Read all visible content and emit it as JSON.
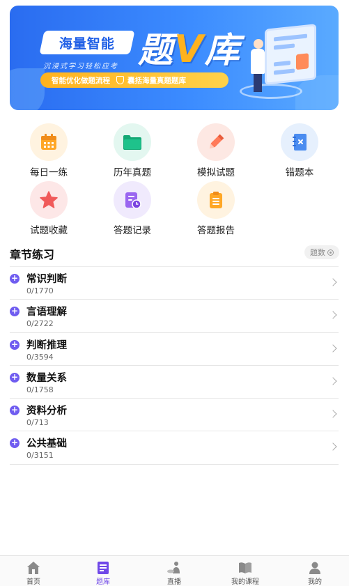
{
  "banner": {
    "brand": "海量智能",
    "title_prefix": "题",
    "title_v": "V",
    "title_suffix": "库",
    "subtitle": "沉浸式学习轻松应考",
    "pill_left": "智能优化做题流程",
    "pill_right": "囊括海量真题题库"
  },
  "grid": {
    "items": [
      {
        "label": "每日一练",
        "icon": "calendar-icon",
        "bg": "#fff3e0",
        "color": "#ffa726"
      },
      {
        "label": "历年真题",
        "icon": "folder-icon",
        "bg": "#e3f7f0",
        "color": "#1ec28b"
      },
      {
        "label": "模拟试题",
        "icon": "pencil-icon",
        "bg": "#fde8e3",
        "color": "#ff7a59"
      },
      {
        "label": "错题本",
        "icon": "notebook-icon",
        "bg": "#e6f0fd",
        "color": "#4a8cf0"
      },
      {
        "label": "试题收藏",
        "icon": "star-icon",
        "bg": "#fde7e7",
        "color": "#f05a5a"
      },
      {
        "label": "答题记录",
        "icon": "record-clock-icon",
        "bg": "#f0eafd",
        "color": "#9a66f0"
      },
      {
        "label": "答题报告",
        "icon": "clipboard-icon",
        "bg": "#fff3e0",
        "color": "#ffa726"
      }
    ]
  },
  "section": {
    "title": "章节练习",
    "count_label": "题数"
  },
  "chapters": [
    {
      "name": "常识判断",
      "progress": "0/1770"
    },
    {
      "name": "言语理解",
      "progress": "0/2722"
    },
    {
      "name": "判断推理",
      "progress": "0/3594"
    },
    {
      "name": "数量关系",
      "progress": "0/1758"
    },
    {
      "name": "资料分析",
      "progress": "0/713"
    },
    {
      "name": "公共基础",
      "progress": "0/3151"
    }
  ],
  "tabbar": {
    "tabs": [
      {
        "label": "首页",
        "icon": "home-icon"
      },
      {
        "label": "题库",
        "icon": "question-bank-icon"
      },
      {
        "label": "直播",
        "icon": "live-icon"
      },
      {
        "label": "我的课程",
        "icon": "book-icon"
      },
      {
        "label": "我的",
        "icon": "profile-icon"
      }
    ],
    "active": "题库",
    "active_color": "#7048e8"
  }
}
